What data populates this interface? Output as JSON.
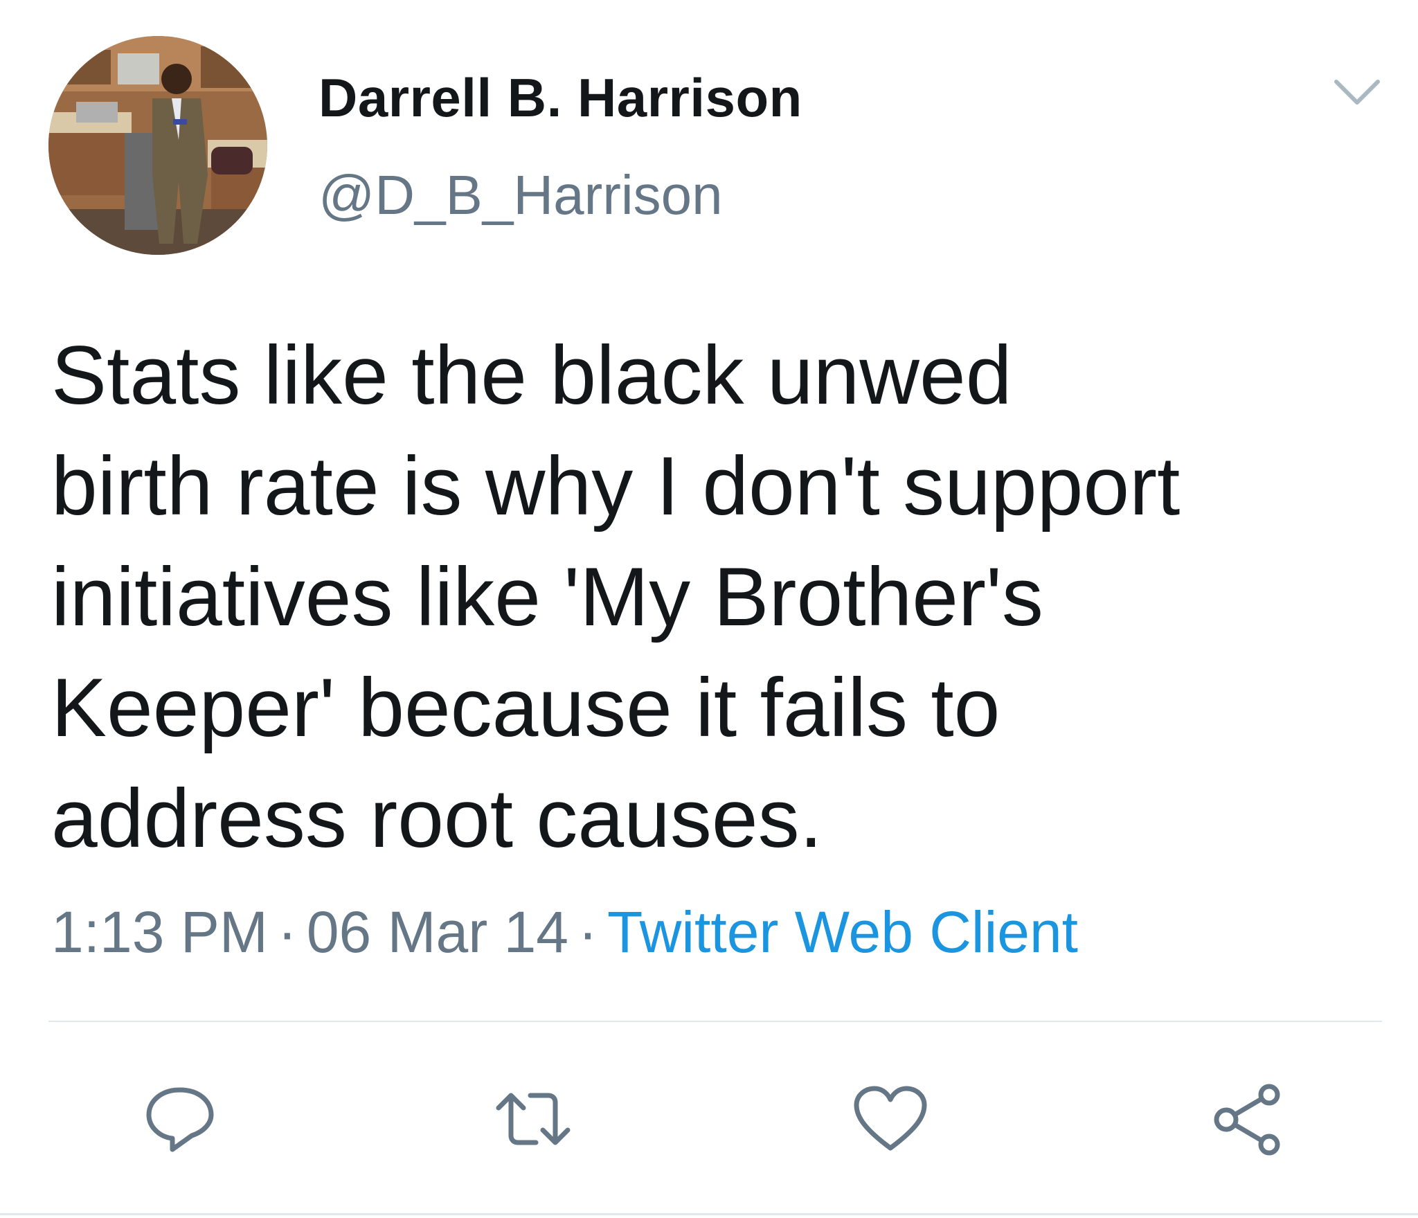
{
  "tweet": {
    "author": {
      "display_name": "Darrell B. Harrison",
      "handle": "@D_B_Harrison"
    },
    "text_lines": [
      "Stats like the black unwed",
      "birth rate is why I don't support",
      "initiatives like 'My Brother's",
      "Keeper' because it fails to",
      "address root causes."
    ],
    "meta": {
      "time": "1:13 PM",
      "separator": "·",
      "date": "06 Mar 14",
      "source": "Twitter Web Client"
    },
    "icons": {
      "menu": "chevron-down-icon",
      "reply": "reply-icon",
      "retweet": "retweet-icon",
      "like": "heart-icon",
      "share": "share-icon"
    },
    "colors": {
      "text": "#14171a",
      "secondary": "#657786",
      "link": "#1b95e0",
      "divider": "#e1e8ed"
    }
  }
}
